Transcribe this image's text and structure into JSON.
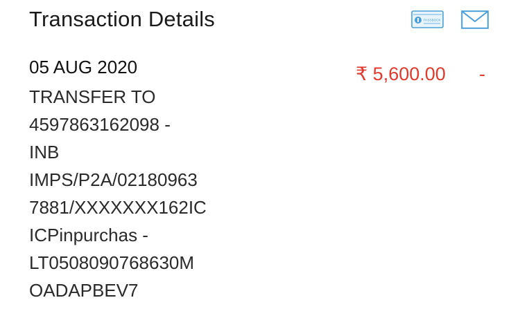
{
  "header": {
    "title": "Transaction Details",
    "passbook_icon": "passbook-icon",
    "passbook_icon_text": "PASSBOOK",
    "mail_icon": "mail-icon",
    "icon_color": "#4a9fd8"
  },
  "transaction": {
    "date": "05 AUG 2020",
    "description_lines": [
      "TRANSFER TO",
      "4597863162098 -",
      "INB",
      "IMPS/P2A/02180963",
      "7881/XXXXXXX162IC",
      "ICPinpurchas -",
      "LT0508090768630M",
      "OADAPBEV7"
    ],
    "amount": "₹ 5,600.00",
    "credit_debit": "-",
    "amount_color": "#e03a2f"
  }
}
